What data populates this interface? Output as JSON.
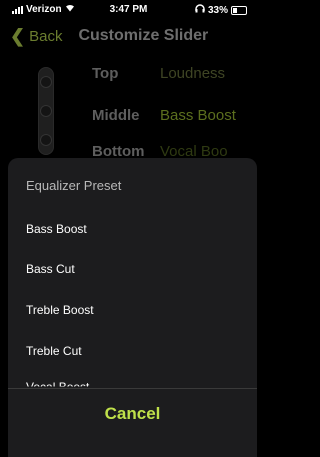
{
  "status_bar": {
    "carrier": "Verizon",
    "time": "3:47 PM",
    "battery": "33%"
  },
  "nav": {
    "back_label": "Back",
    "title": "Customize Slider"
  },
  "slider_rows": [
    {
      "label": "Top",
      "value": "Loudness"
    },
    {
      "label": "Middle",
      "value": "Bass Boost"
    },
    {
      "label": "Bottom",
      "value": "Vocal Boo"
    }
  ],
  "sheet": {
    "title": "Equalizer Preset",
    "options": [
      "Bass Boost",
      "Bass Cut",
      "Treble Boost",
      "Treble Cut",
      "Vocal Boost"
    ],
    "cancel_label": "Cancel"
  },
  "colors": {
    "accent": "#bfe04a",
    "sheet_bg": "#1c1c1e",
    "page_bg": "#000000"
  }
}
